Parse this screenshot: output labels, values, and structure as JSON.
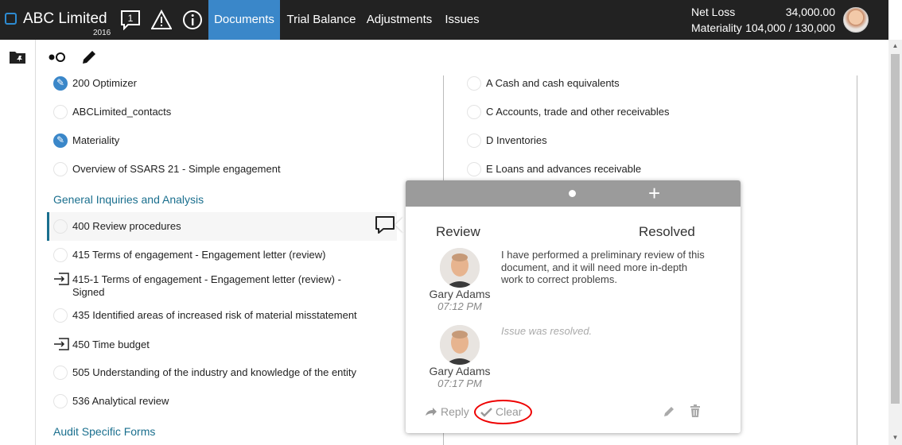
{
  "app": {
    "company": "ABC Limited",
    "year": "2016"
  },
  "top_icons": {
    "tasks_count": "1",
    "icons": [
      "comment-count-icon",
      "warning-icon",
      "info-icon"
    ]
  },
  "nav": {
    "tabs": [
      {
        "label": "Documents",
        "active": true
      },
      {
        "label": "Trial Balance",
        "active": false
      },
      {
        "label": "Adjustments",
        "active": false
      },
      {
        "label": "Issues",
        "active": false
      }
    ]
  },
  "financials": {
    "net_loss_label": "Net Loss",
    "net_loss_value": "34,000.00",
    "materiality_label": "Materiality",
    "materiality_value": "104,000 / 130,000"
  },
  "left_column": {
    "items_top": [
      {
        "label": "200 Optimizer",
        "state": "edited"
      },
      {
        "label": "ABCLimited_contacts",
        "state": "empty"
      },
      {
        "label": "Materiality",
        "state": "edited"
      },
      {
        "label": "Overview of SSARS 21 - Simple engagement",
        "state": "empty"
      }
    ],
    "section_1": "General Inquiries and Analysis",
    "items_section": [
      {
        "label": "400 Review procedures",
        "state": "empty"
      },
      {
        "label": "415 Terms of engagement - Engagement letter (review)",
        "state": "empty"
      },
      {
        "label": "415-1 Terms of engagement - Engagement letter (review) - Signed",
        "state": "export"
      },
      {
        "label": "435 Identified areas of increased risk of material misstatement",
        "state": "empty"
      },
      {
        "label": "450 Time budget",
        "state": "export"
      },
      {
        "label": "505 Understanding of the industry and knowledge of the entity",
        "state": "empty"
      },
      {
        "label": "536 Analytical review",
        "state": "empty"
      }
    ],
    "section_2": "Audit Specific Forms"
  },
  "right_column": {
    "items": [
      {
        "label": "A Cash and cash equivalents"
      },
      {
        "label": "C Accounts, trade and other receivables"
      },
      {
        "label": "D Inventories"
      },
      {
        "label": "E Loans and advances receivable"
      }
    ]
  },
  "popup": {
    "review_label": "Review",
    "resolved_label": "Resolved",
    "comments": [
      {
        "author": "Gary Adams",
        "time": "07:12 PM",
        "text": "I have performed a preliminary review of this document, and it will need more in-depth work to correct problems."
      },
      {
        "author": "Gary Adams",
        "time": "07:17 PM",
        "note": "Issue was resolved."
      }
    ],
    "reply_label": "Reply",
    "clear_label": "Clear",
    "highlight_color": "#e00000"
  },
  "colors": {
    "topbar": "#222222",
    "accent": "#3a87c9",
    "section": "#1a6f8e"
  }
}
